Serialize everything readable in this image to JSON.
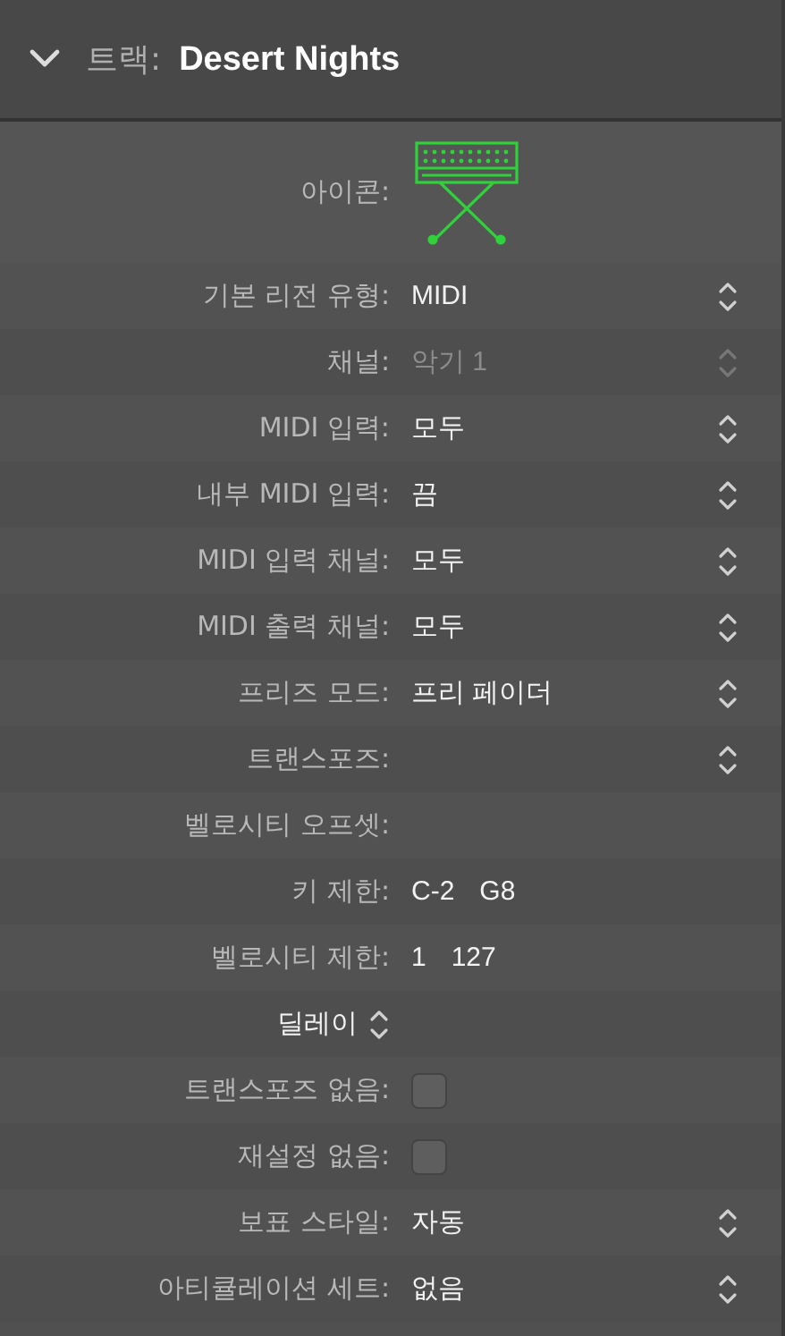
{
  "header": {
    "expanded": true,
    "label": "트랙:",
    "title": "Desert Nights"
  },
  "icon_row": {
    "label": "아이콘:"
  },
  "rows": [
    {
      "kind": "popup",
      "label": "기본 리전 유형:",
      "value": "MIDI",
      "disabled": false
    },
    {
      "kind": "popup",
      "label": "채널:",
      "value": "악기 1",
      "disabled": true
    },
    {
      "kind": "popup",
      "label": "MIDI 입력:",
      "value": "모두",
      "disabled": false
    },
    {
      "kind": "popup",
      "label": "내부 MIDI 입력:",
      "value": "끔",
      "disabled": false
    },
    {
      "kind": "popup",
      "label": "MIDI 입력 채널:",
      "value": "모두",
      "disabled": false
    },
    {
      "kind": "popup",
      "label": "MIDI 출력 채널:",
      "value": "모두",
      "disabled": false
    },
    {
      "kind": "popup",
      "label": "프리즈 모드:",
      "value": "프리 페이더",
      "disabled": false
    },
    {
      "kind": "popup",
      "label": "트랜스포즈:",
      "disabled": false
    },
    {
      "kind": "text",
      "label": "벨로시티 오프셋:"
    },
    {
      "kind": "range",
      "label": "키 제한:",
      "values": [
        "C-2",
        "G8"
      ]
    },
    {
      "kind": "range",
      "label": "벨로시티 제한:",
      "values": [
        "1",
        "127"
      ]
    },
    {
      "kind": "section",
      "label": "딜레이"
    },
    {
      "kind": "checkbox",
      "label": "트랜스포즈 없음:",
      "checked": false
    },
    {
      "kind": "checkbox",
      "label": "재설정 없음:",
      "checked": false
    },
    {
      "kind": "popup",
      "label": "보표 스타일:",
      "value": "자동",
      "disabled": false
    },
    {
      "kind": "popup",
      "label": "아티큘레이션 세트:",
      "value": "없음",
      "disabled": false
    }
  ]
}
